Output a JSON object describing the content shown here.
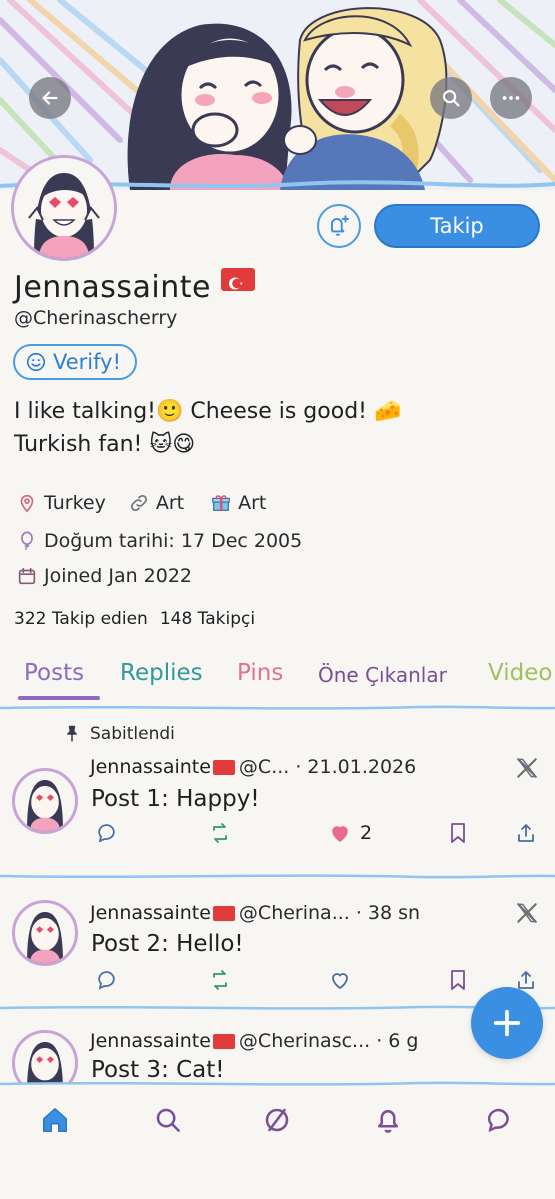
{
  "header": {
    "back_icon": "arrow-left-icon",
    "search_icon": "search-icon",
    "more_icon": "more-horizontal-icon"
  },
  "profile": {
    "display_name": "Jennassainte",
    "flag": "🇹🇷",
    "handle": "@Cherinascherry",
    "verify_label": "Verify!",
    "follow_label": "Takip",
    "bio_line1": "I like talking!🙂 Cheese is good! 🧀",
    "bio_line2": "Turkish fan! 🐱😋",
    "location": "Turkey",
    "link": "Art",
    "gift": "Art",
    "birthday": "Doğum tarihi: 17 Dec 2005",
    "joined": "Joined Jan 2022",
    "following": "322 Takip edien",
    "followers": "148 Takipçi"
  },
  "tabs": [
    {
      "label": "Posts"
    },
    {
      "label": "Replies"
    },
    {
      "label": "Pins"
    },
    {
      "label": "Öne Çıkanlar"
    },
    {
      "label": "Video"
    }
  ],
  "posts": [
    {
      "pinned_label": "Sabitlendi",
      "name": "Jennassainte",
      "handle_time": "@C... · 21.01.2026",
      "text": "Post 1: Happy!",
      "likes": "2",
      "liked": true
    },
    {
      "name": "Jennassainte",
      "handle_time": "@Cherina... · 38 sn",
      "text": "Post 2: Hello!",
      "likes": "",
      "liked": false
    },
    {
      "name": "Jennassainte",
      "handle_time": "@Cherinasc... · 6 g",
      "text": "Post 3: Cat!"
    }
  ],
  "colors": {
    "accent": "#3a8fe2",
    "like": "#e86a8a",
    "retweet": "#2f9a6a",
    "tab_posts": "#8b6ac0"
  }
}
